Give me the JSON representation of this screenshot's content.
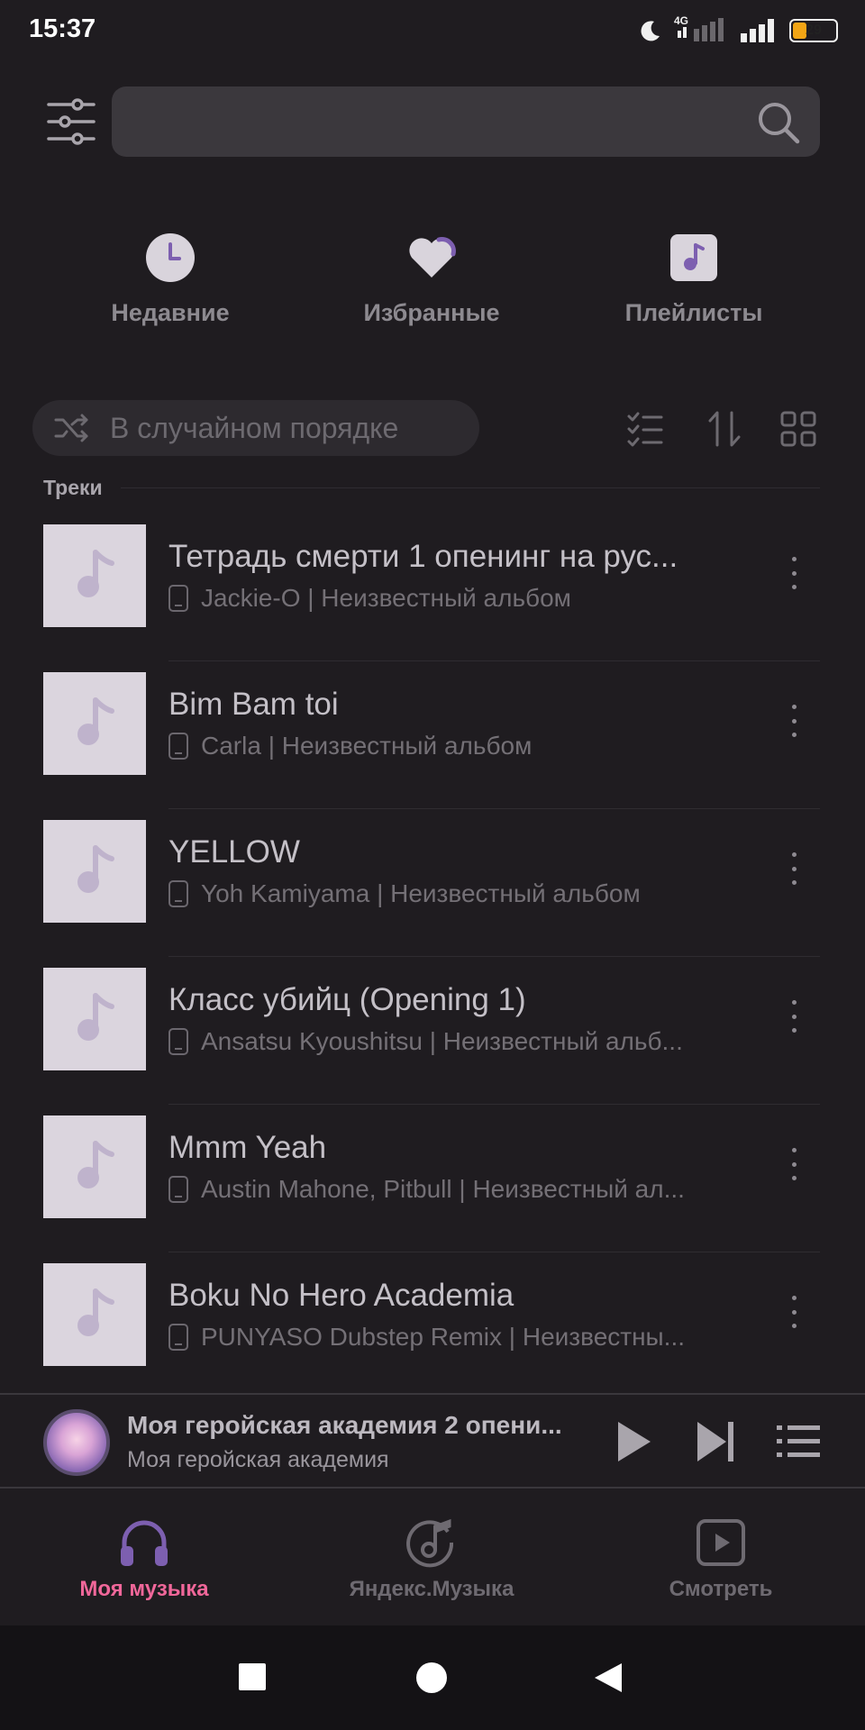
{
  "status_bar": {
    "time": "15:37",
    "network": "4G",
    "battery": "29"
  },
  "search": {
    "placeholder": ""
  },
  "quick_access": [
    {
      "label": "Недавние",
      "icon": "clock-icon"
    },
    {
      "label": "Избранные",
      "icon": "heart-icon"
    },
    {
      "label": "Плейлисты",
      "icon": "playlist-icon"
    }
  ],
  "controls": {
    "shuffle_label": "В случайном порядке"
  },
  "section": {
    "title": "Треки"
  },
  "tracks": [
    {
      "title": "Тетрадь смерти 1 опенинг на рус...",
      "subtitle": "Jackie-O | Неизвестный альбом"
    },
    {
      "title": "Bim Bam toi",
      "subtitle": "Carla | Неизвестный альбом"
    },
    {
      "title": "YELLOW",
      "subtitle": "Yoh Kamiyama | Неизвестный альбом"
    },
    {
      "title": "Класс убийц (Opening 1)",
      "subtitle": "Ansatsu Kyoushitsu | Неизвестный альб..."
    },
    {
      "title": "Mmm Yeah",
      "subtitle": "Austin Mahone, Pitbull | Неизвестный ал..."
    },
    {
      "title": "Boku No Hero Academia",
      "subtitle": "PUNYASO Dubstep Remix | Неизвестны..."
    }
  ],
  "now_playing": {
    "title": "Моя геройская академия 2 опени...",
    "subtitle": "Моя геройская академия"
  },
  "bottom_nav": [
    {
      "label": "Моя музыка",
      "active": true,
      "icon": "headphones-icon"
    },
    {
      "label": "Яндекс.Музыка",
      "active": false,
      "icon": "music-note-circle-icon"
    },
    {
      "label": "Смотреть",
      "active": false,
      "icon": "video-play-icon"
    }
  ],
  "colors": {
    "background": "#1f1c20",
    "accent": "#7d5fb0",
    "active_label": "#f0679a",
    "inactive": "#6e6a71"
  }
}
